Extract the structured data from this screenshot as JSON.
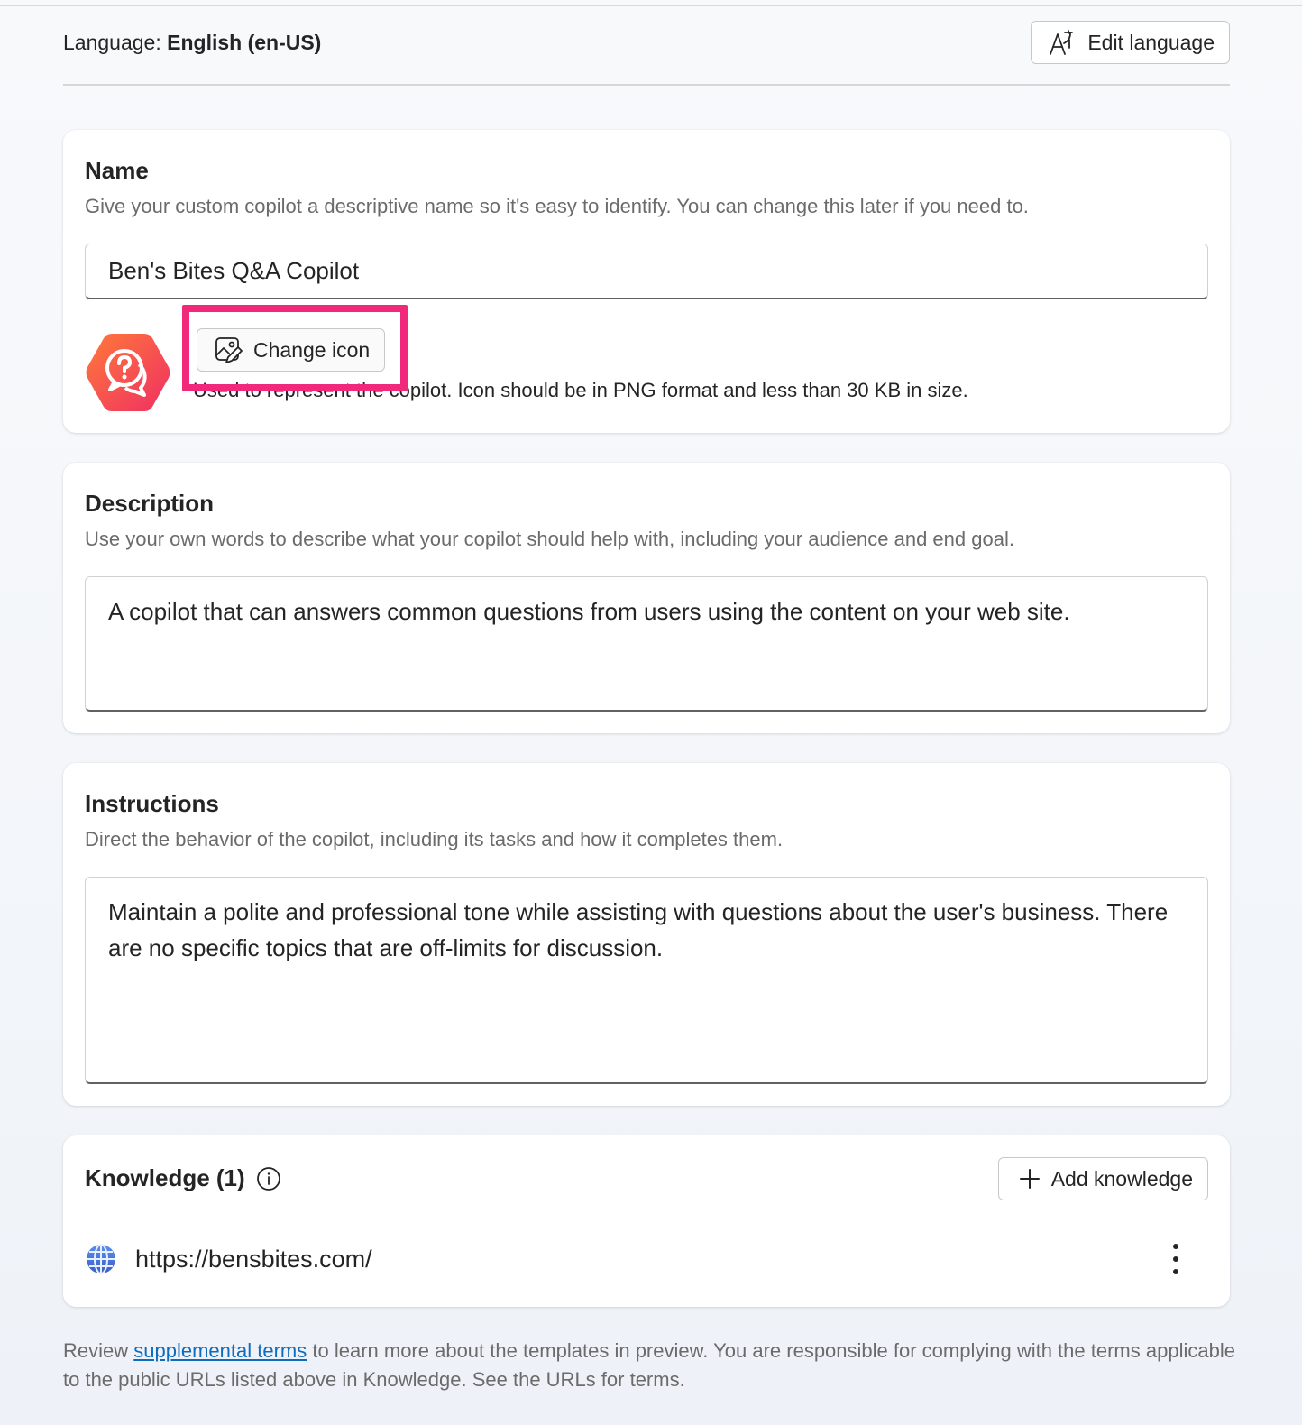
{
  "language": {
    "prefix": "Language:",
    "value": "English (en-US)",
    "edit_button": "Edit language"
  },
  "name_card": {
    "title": "Name",
    "subtitle": "Give your custom copilot a descriptive name so it's easy to identify. You can change this later if you need to.",
    "value": "Ben's Bites Q&A Copilot",
    "change_icon_button": "Change icon",
    "icon_help": "Used to represent the copilot. Icon should be in PNG format and less than 30 KB in size."
  },
  "description_card": {
    "title": "Description",
    "subtitle": "Use your own words to describe what your copilot should help with, including your audience and end goal.",
    "value": "A copilot that can answers common questions from users using the content on your web site."
  },
  "instructions_card": {
    "title": "Instructions",
    "subtitle": "Direct the behavior of the copilot, including its tasks and how it completes them.",
    "value": "Maintain a polite and professional tone while assisting with questions about the user's business. There are no specific topics that are off-limits for discussion."
  },
  "knowledge_card": {
    "title": "Knowledge (1)",
    "add_button": "Add knowledge",
    "items": [
      {
        "url": "https://bensbites.com/"
      }
    ]
  },
  "footer": {
    "prefix": "Review",
    "link": "supplemental terms",
    "suffix": "to learn more about the templates in preview. You are responsible for complying with the terms applicable to the public URLs listed above in Knowledge. See the URLs for terms."
  },
  "colors": {
    "highlight": "#f0297a",
    "avatar_gradient_start": "#ff6a3d",
    "avatar_gradient_end": "#f0335f",
    "link": "#0f6cbd"
  }
}
